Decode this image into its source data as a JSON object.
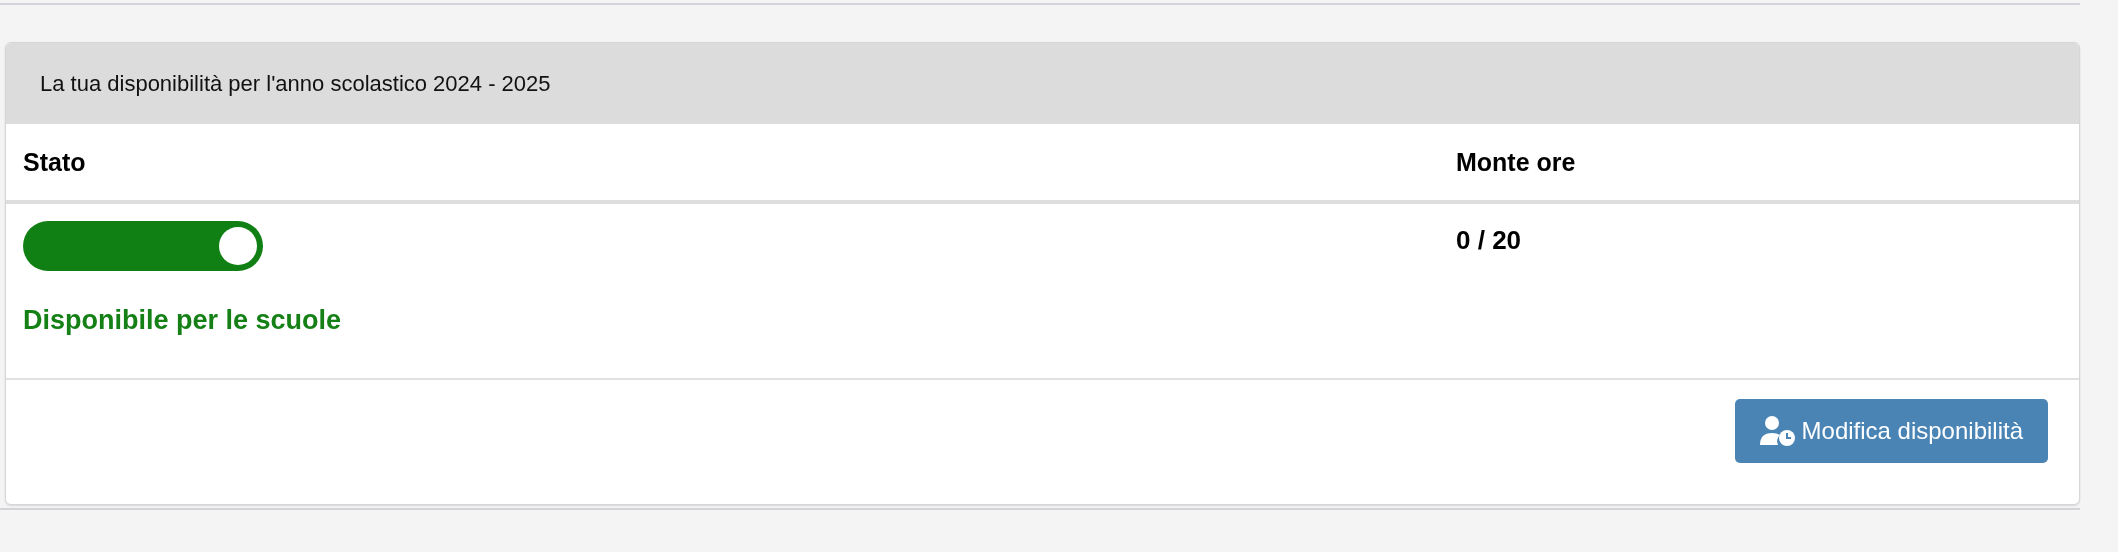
{
  "panel": {
    "title": "La tua disponibilità per l'anno scolastico 2024 - 2025",
    "columns": [
      "Stato",
      "Monte ore"
    ],
    "row": {
      "availability": {
        "on": true
      },
      "status": "Disponibile per le scuole",
      "hours": "0 / 20"
    },
    "button": {
      "label": "Modifica disponibilità"
    }
  }
}
